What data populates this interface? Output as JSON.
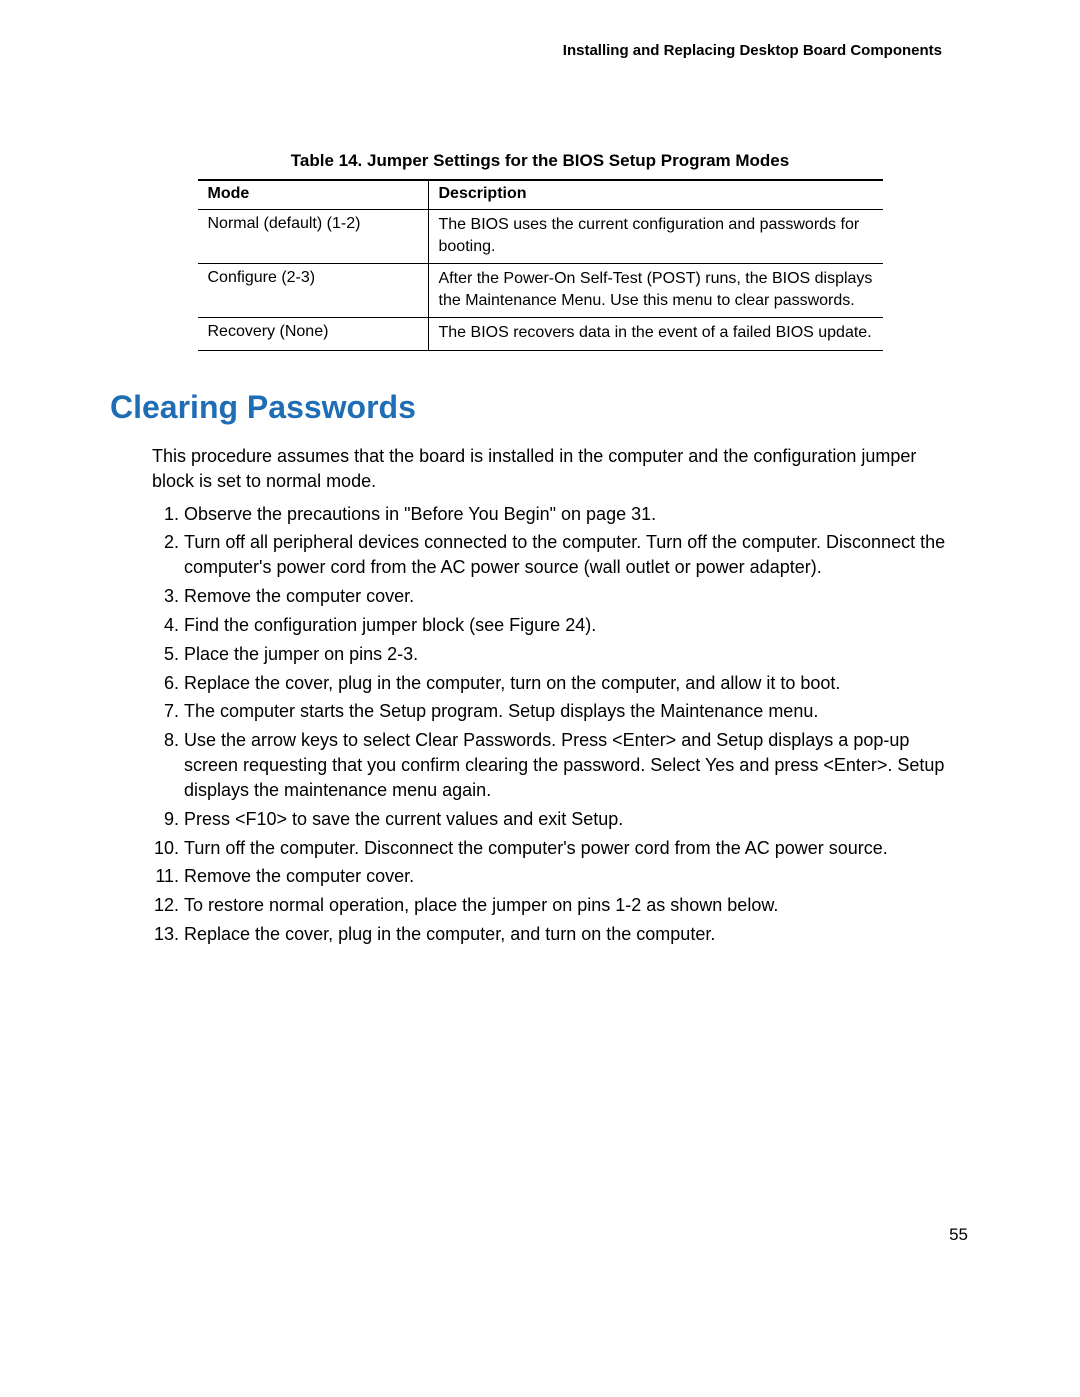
{
  "header": {
    "running_title": "Installing and Replacing Desktop Board Components"
  },
  "table": {
    "caption": "Table 14. Jumper Settings for the BIOS Setup Program Modes",
    "columns": [
      "Mode",
      "Description"
    ],
    "rows": [
      {
        "mode": "Normal (default) (1-2)",
        "description": "The BIOS uses the current configuration and passwords for booting."
      },
      {
        "mode": "Configure (2-3)",
        "description": "After the Power-On Self-Test (POST) runs, the BIOS displays the Maintenance Menu.  Use this menu to clear passwords."
      },
      {
        "mode": "Recovery (None)",
        "description": "The BIOS recovers data in the event of a failed BIOS update."
      }
    ]
  },
  "section": {
    "title": "Clearing Passwords",
    "intro": "This procedure assumes that the board is installed in the computer and the configuration jumper block is set to normal mode.",
    "steps": [
      "Observe the precautions in \"Before You Begin\" on page 31.",
      "Turn off all peripheral devices connected to the computer.  Turn off the computer. Disconnect the computer's power cord from the AC power source (wall outlet or power adapter).",
      "Remove the computer cover.",
      "Find the configuration jumper block (see Figure 24).",
      "Place the jumper on pins 2-3.",
      "Replace the cover, plug in the computer, turn on the computer, and allow it to boot.",
      "The computer starts the Setup program.  Setup displays the Maintenance menu.",
      "Use the arrow keys to select Clear Passwords.  Press <Enter> and Setup displays a pop-up screen requesting that you confirm clearing the password.  Select Yes and press <Enter>.  Setup displays the maintenance menu again.",
      "Press <F10> to save the current values and exit Setup.",
      "Turn off the computer.  Disconnect the computer's power cord from the AC power source.",
      "Remove the computer cover.",
      "To restore normal operation, place the jumper on pins 1-2 as shown below.",
      "Replace the cover, plug in the computer, and turn on the computer."
    ]
  },
  "page_number": "55"
}
